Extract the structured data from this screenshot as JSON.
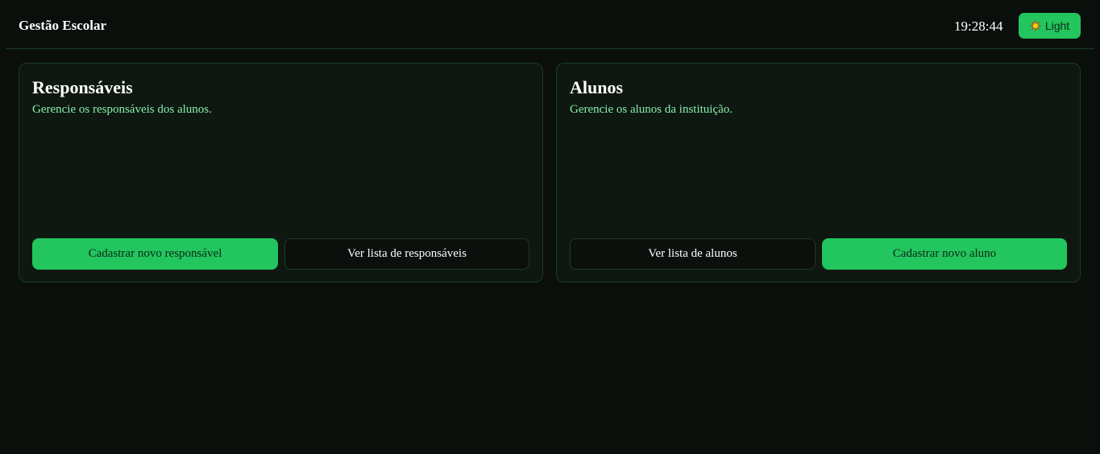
{
  "header": {
    "title": "Gestão Escolar",
    "clock": "19:28:44",
    "theme_button": {
      "label": "Light",
      "icon": "sun-icon"
    }
  },
  "cards": [
    {
      "title": "Responsáveis",
      "description": "Gerencie os responsáveis dos alunos.",
      "buttons": [
        {
          "label": "Cadastrar novo responsável",
          "style": "primary"
        },
        {
          "label": "Ver lista de responsáveis",
          "style": "secondary"
        }
      ]
    },
    {
      "title": "Alunos",
      "description": "Gerencie os alunos da instituição.",
      "buttons": [
        {
          "label": "Ver lista de alunos",
          "style": "secondary"
        },
        {
          "label": "Cadastrar novo aluno",
          "style": "primary"
        }
      ]
    }
  ],
  "colors": {
    "background": "#0b0f0b",
    "accent": "#22c55e",
    "description_text": "#86efac",
    "border": "#1b3a25"
  }
}
